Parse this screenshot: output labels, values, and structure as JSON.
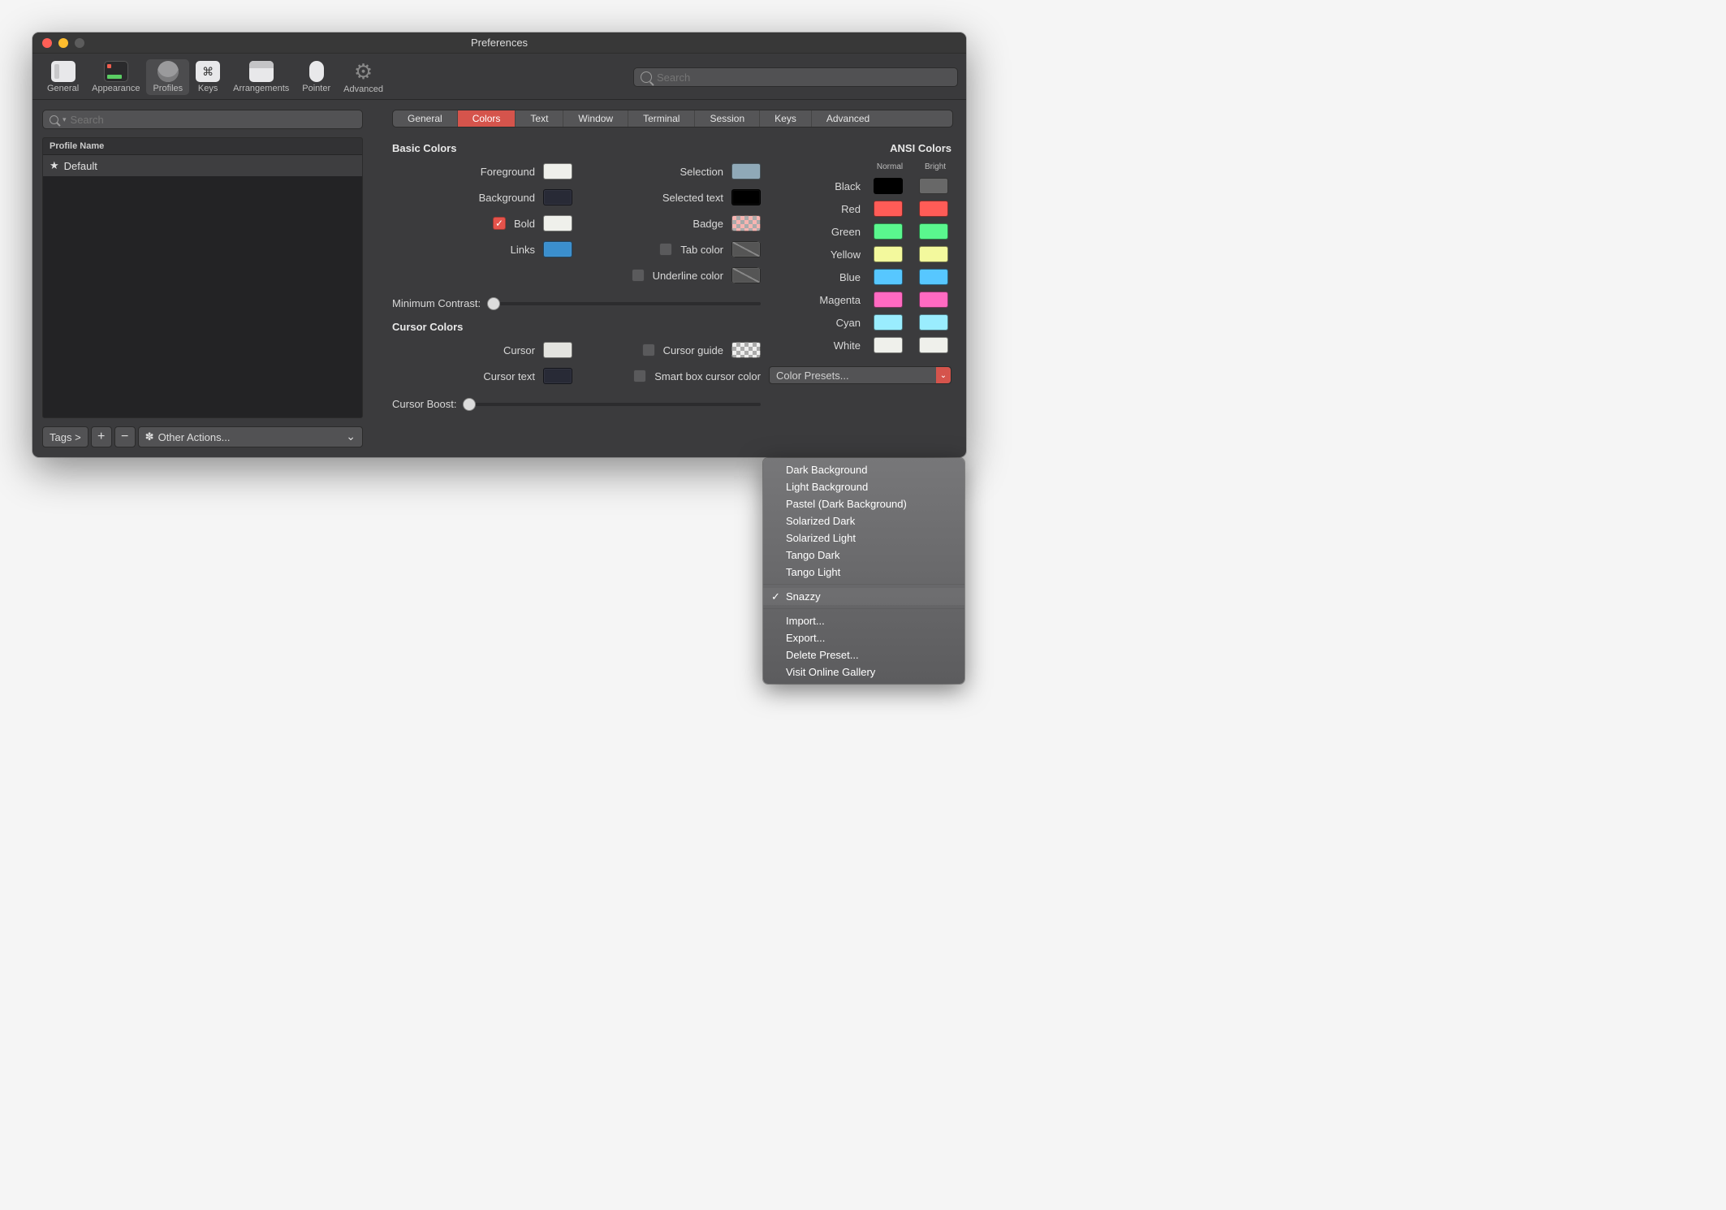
{
  "window": {
    "title": "Preferences"
  },
  "toolbar": {
    "items": [
      {
        "label": "General"
      },
      {
        "label": "Appearance"
      },
      {
        "label": "Profiles"
      },
      {
        "label": "Keys"
      },
      {
        "label": "Arrangements"
      },
      {
        "label": "Pointer"
      },
      {
        "label": "Advanced"
      }
    ],
    "search_placeholder": "Search"
  },
  "sidebar": {
    "search_placeholder": "Search",
    "header": "Profile Name",
    "profiles": [
      {
        "name": "Default"
      }
    ],
    "tags_label": "Tags >",
    "other_actions_label": "Other Actions..."
  },
  "tabs": [
    "General",
    "Colors",
    "Text",
    "Window",
    "Terminal",
    "Session",
    "Keys",
    "Advanced"
  ],
  "basic": {
    "title": "Basic Colors",
    "foreground": {
      "label": "Foreground",
      "color": "#eff0eb"
    },
    "background_": {
      "label": "Background",
      "color": "#282a36"
    },
    "bold": {
      "label": "Bold",
      "color": "#eff0eb",
      "checked": true
    },
    "links": {
      "label": "Links",
      "color": "#3b8fce"
    },
    "selection": {
      "label": "Selection",
      "color": "#8fa9b8"
    },
    "selected_text": {
      "label": "Selected text",
      "color": "#000000"
    },
    "badge": {
      "label": "Badge"
    },
    "tab_color": {
      "label": "Tab color"
    },
    "underline_color": {
      "label": "Underline color"
    },
    "min_contrast": "Minimum Contrast:"
  },
  "cursor": {
    "title": "Cursor Colors",
    "cursor_": {
      "label": "Cursor",
      "color": "#e4e4e0"
    },
    "cursor_text": {
      "label": "Cursor text",
      "color": "#282a36"
    },
    "cursor_guide": {
      "label": "Cursor guide"
    },
    "smart_box": {
      "label": "Smart box cursor color"
    },
    "boost": "Cursor Boost:"
  },
  "ansi": {
    "title": "ANSI Colors",
    "normal_h": "Normal",
    "bright_h": "Bright",
    "rows": [
      {
        "label": "Black",
        "n": "#000000",
        "b": "#686868"
      },
      {
        "label": "Red",
        "n": "#ff5c57",
        "b": "#ff5c57"
      },
      {
        "label": "Green",
        "n": "#5af78e",
        "b": "#5af78e"
      },
      {
        "label": "Yellow",
        "n": "#f3f99d",
        "b": "#f3f99d"
      },
      {
        "label": "Blue",
        "n": "#57c7ff",
        "b": "#57c7ff"
      },
      {
        "label": "Magenta",
        "n": "#ff6ac1",
        "b": "#ff6ac1"
      },
      {
        "label": "Cyan",
        "n": "#9aedfe",
        "b": "#9aedfe"
      },
      {
        "label": "White",
        "n": "#eff0eb",
        "b": "#eff0eb"
      }
    ],
    "preset_label": "Color Presets..."
  },
  "dropdown": {
    "presets": [
      "Dark Background",
      "Light Background",
      "Pastel (Dark Background)",
      "Solarized Dark",
      "Solarized Light",
      "Tango Dark",
      "Tango Light"
    ],
    "selected": "Snazzy",
    "actions": [
      "Import...",
      "Export...",
      "Delete Preset...",
      "Visit Online Gallery"
    ]
  }
}
